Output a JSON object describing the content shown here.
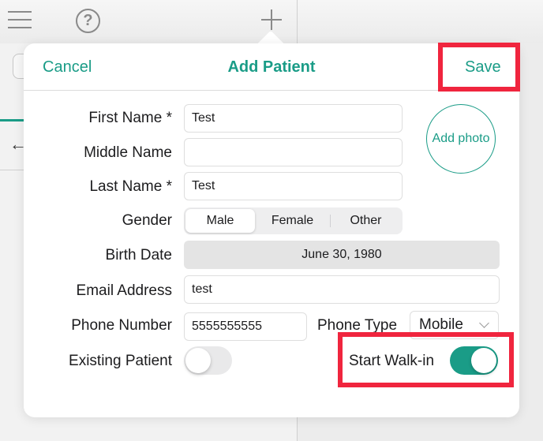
{
  "background": {
    "toolbar_icons": [
      "menu-icon",
      "help-icon",
      "add-icon"
    ],
    "back_icon": "arrow-left-icon"
  },
  "popover": {
    "nav": {
      "cancel_label": "Cancel",
      "title": "Add Patient",
      "save_label": "Save"
    },
    "add_photo_label": "Add photo",
    "fields": {
      "first_name": {
        "label": "First Name *",
        "value": "Test"
      },
      "middle_name": {
        "label": "Middle Name",
        "value": ""
      },
      "last_name": {
        "label": "Last Name *",
        "value": "Test"
      },
      "gender": {
        "label": "Gender",
        "options": [
          "Male",
          "Female",
          "Other"
        ],
        "selected": "Male"
      },
      "birth_date": {
        "label": "Birth Date",
        "value": "June 30, 1980"
      },
      "email": {
        "label": "Email Address",
        "value": "test"
      },
      "phone_number": {
        "label": "Phone Number",
        "value": "5555555555"
      },
      "phone_type": {
        "label": "Phone Type",
        "value": "Mobile"
      },
      "existing_patient": {
        "label": "Existing Patient",
        "on": false
      },
      "start_walk_in": {
        "label": "Start Walk-in",
        "on": true
      }
    }
  },
  "colors": {
    "accent": "#1a9c87",
    "highlight": "#f0253e"
  }
}
